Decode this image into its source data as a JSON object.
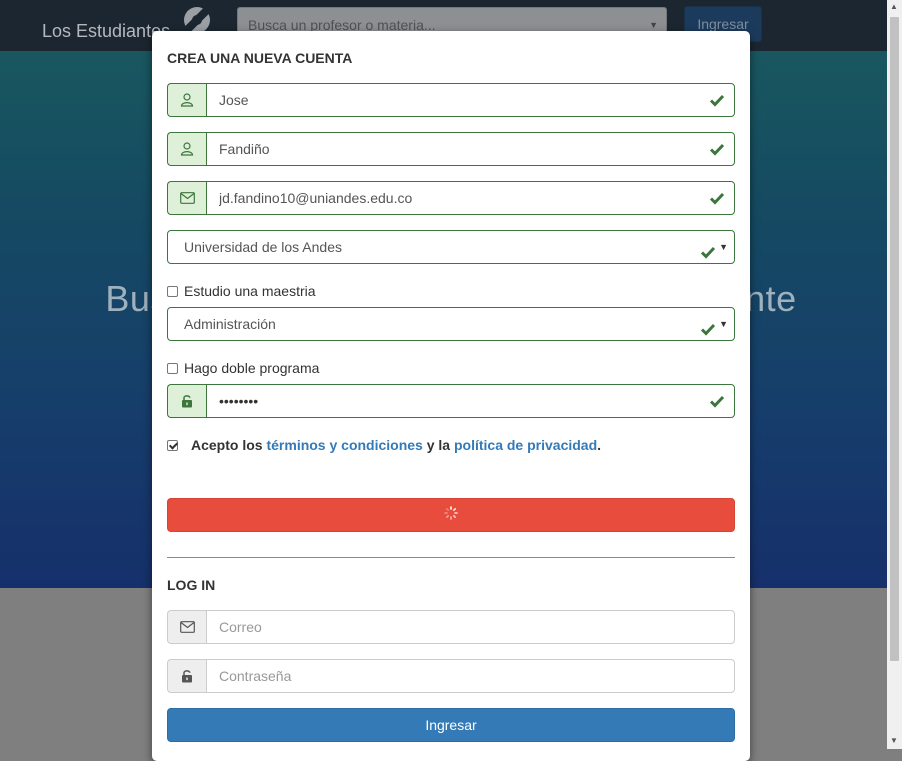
{
  "nav": {
    "brand": "Los Estudiantes",
    "search_placeholder": "Busca un profesor o materia...",
    "login_button": "Ingresar"
  },
  "hero": {
    "title": "Busca tu profesor y califícalo rápidamente"
  },
  "signup": {
    "heading": "CREA UNA NUEVA CUENTA",
    "first_name": "Jose",
    "last_name": "Fandiño",
    "email": "jd.fandino10@uniandes.edu.co",
    "university": "Universidad de los Andes",
    "masters_label": "Estudio una maestria",
    "masters_checked": false,
    "department": "Administración",
    "double_program_label": "Hago doble programa",
    "double_program_checked": false,
    "password_mask": "••••••••",
    "terms_checked": true,
    "terms_prefix": "Acepto los",
    "terms_link": "términos y condiciones",
    "terms_middle": "y la",
    "privacy_link": "política de privacidad",
    "terms_suffix": ".",
    "submit_state": "loading"
  },
  "login": {
    "heading": "LOG IN",
    "email_placeholder": "Correo",
    "password_placeholder": "Contraseña",
    "submit_label": "Ingresar"
  },
  "colors": {
    "success": "#3c763d",
    "danger_button": "#e74c3c",
    "primary_button": "#337ab7",
    "link": "#337ab7"
  },
  "icons": [
    "user-icon",
    "envelope-icon",
    "unlock-icon",
    "check-icon",
    "caret-down-icon",
    "spinner-icon",
    "brand-logo-icon"
  ]
}
